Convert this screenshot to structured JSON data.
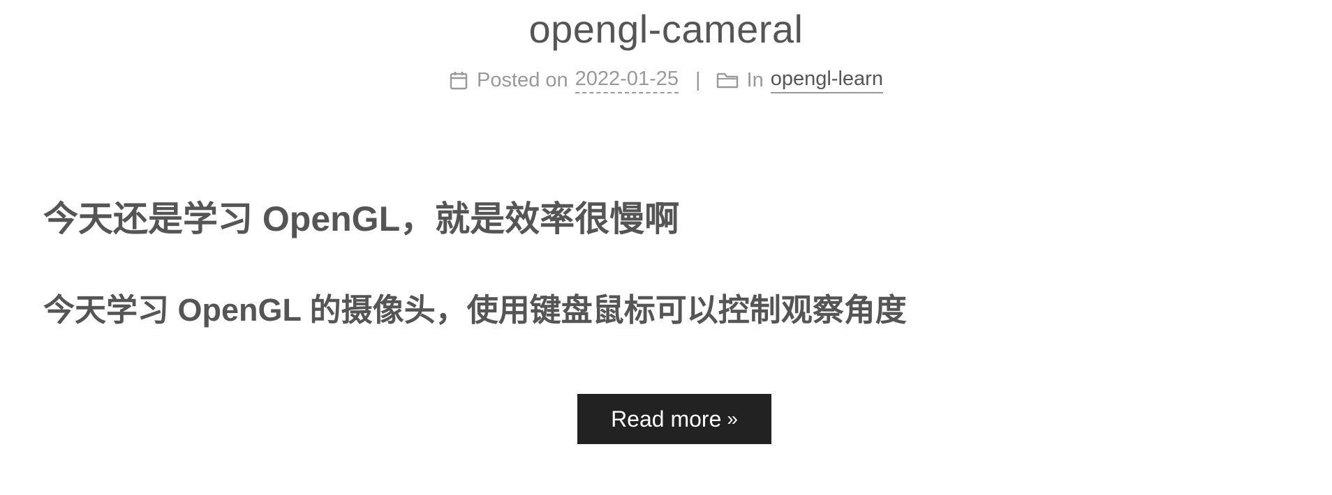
{
  "post": {
    "title": "opengl-cameral",
    "meta": {
      "posted_label": "Posted on",
      "date": "2022-01-25",
      "divider": "|",
      "in_label": "In",
      "category": "opengl-learn",
      "calendar_icon": "calendar-icon",
      "folder_icon": "folder-icon"
    },
    "body": {
      "heading1": "今天还是学习 OpenGL，就是效率很慢啊",
      "heading2": "今天学习 OpenGL 的摄像头，使用键盘鼠标可以控制观察角度"
    },
    "read_more": {
      "label": "Read more",
      "arrow": "»"
    },
    "colors": {
      "text": "#555555",
      "meta": "#999999",
      "button_bg": "#222222",
      "button_text": "#ffffff"
    }
  }
}
